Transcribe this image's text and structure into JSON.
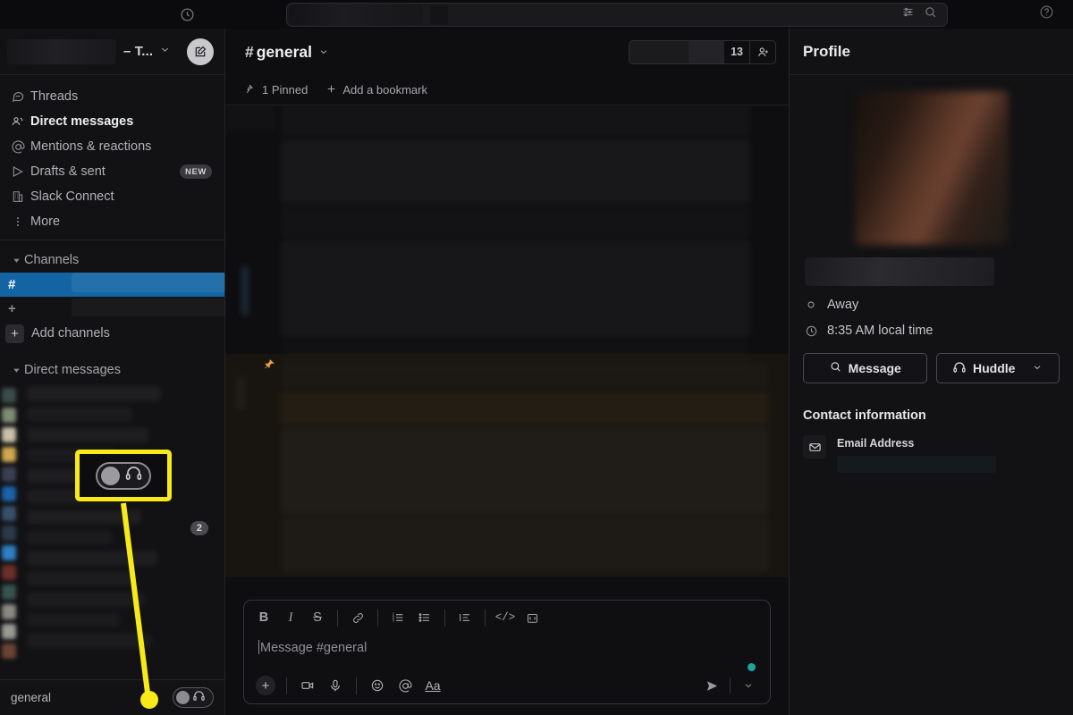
{
  "topbar": {
    "history_icon": "clock-icon",
    "search_placeholder": "",
    "filter_icon": "filter-icon",
    "search_icon": "search-icon",
    "help_icon": "help-icon"
  },
  "sidebar": {
    "workspace": {
      "name_suffix": "– T...",
      "caret_icon": "chevron-down-icon",
      "compose_icon": "compose-icon"
    },
    "nav": [
      {
        "label": "Threads",
        "icon": "threads-icon",
        "bold": false,
        "badge": ""
      },
      {
        "label": "Direct messages",
        "icon": "direct-messages-icon",
        "bold": true,
        "badge": ""
      },
      {
        "label": "Mentions & reactions",
        "icon": "at-icon",
        "bold": false,
        "badge": ""
      },
      {
        "label": "Drafts & sent",
        "icon": "send-icon",
        "bold": false,
        "badge": "NEW"
      },
      {
        "label": "Slack Connect",
        "icon": "building-icon",
        "bold": false,
        "badge": ""
      },
      {
        "label": "More",
        "icon": "more-icon",
        "bold": false,
        "badge": ""
      }
    ],
    "channels_section": {
      "title": "Channels",
      "add_channels_label": "Add channels",
      "plus_glyph": "+",
      "hash_glyph": "#"
    },
    "dm_section": {
      "title": "Direct messages",
      "unread_badge": "2"
    },
    "footer": {
      "label": "general",
      "huddle_icon": "headphones-icon"
    }
  },
  "channel": {
    "hash": "#",
    "name": "general",
    "caret_icon": "chevron-down-icon",
    "member_count": "13",
    "add_member_icon": "add-person-icon",
    "bookmarks": [
      {
        "label": "1 Pinned",
        "icon": "pin-icon"
      },
      {
        "label": "Add a bookmark",
        "icon": "plus-icon"
      }
    ],
    "pin_glyph": "📌"
  },
  "composer": {
    "placeholder": "Message #general",
    "format_buttons": [
      {
        "name": "bold-button",
        "glyph": "B"
      },
      {
        "name": "italic-button",
        "glyph": "I"
      },
      {
        "name": "strikethrough-button",
        "glyph": "S"
      },
      {
        "name": "link-button",
        "glyph": "link"
      },
      {
        "name": "ordered-list-button",
        "glyph": "ol"
      },
      {
        "name": "bulleted-list-button",
        "glyph": "ul"
      },
      {
        "name": "blockquote-button",
        "glyph": "bq"
      },
      {
        "name": "code-button",
        "glyph": "</>"
      },
      {
        "name": "code-block-button",
        "glyph": "cb"
      }
    ],
    "action_buttons": [
      {
        "name": "attach-button",
        "glyph": "+"
      },
      {
        "name": "video-clip-button",
        "glyph": "video"
      },
      {
        "name": "audio-clip-button",
        "glyph": "mic"
      },
      {
        "name": "emoji-button",
        "glyph": "emoji"
      },
      {
        "name": "mention-button",
        "glyph": "@"
      },
      {
        "name": "formatting-button",
        "glyph": "Aa"
      }
    ],
    "send_icon": "send-icon",
    "send_options_icon": "chevron-down-icon",
    "status_dot_color": "#19a6a0"
  },
  "profile": {
    "title": "Profile",
    "status_label": "Away",
    "status_icon": "away-circle-icon",
    "local_time": "8:35 AM local time",
    "clock_icon": "clock-icon",
    "message_button": "Message",
    "message_icon": "search-message-icon",
    "huddle_button": "Huddle",
    "huddle_icon": "headphones-icon",
    "huddle_caret": "chevron-down-icon",
    "contact_section_title": "Contact information",
    "email_label": "Email Address",
    "email_icon": "envelope-icon"
  },
  "annotation": {
    "highlight_color": "#f7ea18",
    "callout_target": "huddle-toggle",
    "toggle_icon": "headphones-icon"
  },
  "colors": {
    "accent_blue": "#1264a3",
    "highlight_yellow": "#f7ea18",
    "teal_dot": "#19a6a0",
    "sidebar_bg": "#121214",
    "main_bg": "#0e0e10"
  }
}
